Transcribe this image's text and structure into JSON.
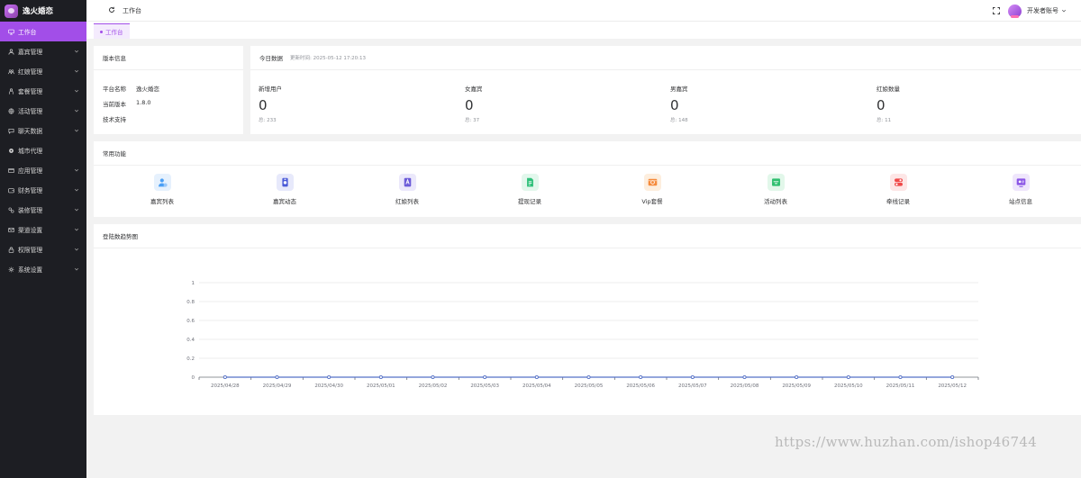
{
  "app": {
    "title": "逸火婚恋"
  },
  "sidebar": {
    "items": [
      {
        "label": "工作台",
        "icon": "monitor-icon",
        "active": true,
        "expandable": false
      },
      {
        "label": "嘉宾管理",
        "icon": "user-icon",
        "expandable": true
      },
      {
        "label": "红娘管理",
        "icon": "group-icon",
        "expandable": true
      },
      {
        "label": "套餐管理",
        "icon": "person-icon",
        "expandable": true
      },
      {
        "label": "活动管理",
        "icon": "globe-icon",
        "expandable": true
      },
      {
        "label": "聊天数据",
        "icon": "chat-icon",
        "expandable": true
      },
      {
        "label": "城市代理",
        "icon": "gear-dot-icon",
        "expandable": false
      },
      {
        "label": "应用管理",
        "icon": "app-icon",
        "expandable": true
      },
      {
        "label": "财务管理",
        "icon": "wallet-icon",
        "expandable": true
      },
      {
        "label": "装修管理",
        "icon": "brush-icon",
        "expandable": true
      },
      {
        "label": "渠道设置",
        "icon": "mail-icon",
        "expandable": true
      },
      {
        "label": "权限管理",
        "icon": "lock-icon",
        "expandable": true
      },
      {
        "label": "系统设置",
        "icon": "settings-icon",
        "expandable": true
      }
    ]
  },
  "header": {
    "breadcrumb": "工作台",
    "user_name": "开发者账号"
  },
  "tabs": {
    "active_label": "工作台"
  },
  "version_card": {
    "title": "版本信息",
    "rows": [
      {
        "key": "平台名称",
        "value": "逸火婚恋"
      },
      {
        "key": "当前版本",
        "value": "1.8.0"
      },
      {
        "key": "技术支持",
        "value": ""
      }
    ]
  },
  "today_card": {
    "title": "今日数据",
    "update_time": "更新时间: 2025-05-12 17:20:13",
    "stats": [
      {
        "label": "新增用户",
        "value": "0",
        "total": "总: 233"
      },
      {
        "label": "女嘉宾",
        "value": "0",
        "total": "总: 37"
      },
      {
        "label": "男嘉宾",
        "value": "0",
        "total": "总: 148"
      },
      {
        "label": "红娘数量",
        "value": "0",
        "total": "总: 11"
      }
    ]
  },
  "common_card": {
    "title": "常用功能",
    "items": [
      {
        "label": "嘉宾列表",
        "icon": "guest-list-icon",
        "color": "#4a9ff5",
        "bg": "#e6f1fd"
      },
      {
        "label": "嘉宾动态",
        "icon": "guest-moment-icon",
        "color": "#4b5bd8",
        "bg": "#e7e9fb"
      },
      {
        "label": "红娘列表",
        "icon": "matchmaker-list-icon",
        "color": "#6b5bd8",
        "bg": "#ebe8fb"
      },
      {
        "label": "提现记录",
        "icon": "withdraw-record-icon",
        "color": "#2fc07a",
        "bg": "#e2f7ec"
      },
      {
        "label": "Vip套餐",
        "icon": "vip-package-icon",
        "color": "#f58a3b",
        "bg": "#fdeede"
      },
      {
        "label": "活动列表",
        "icon": "activity-list-icon",
        "color": "#2fbf6f",
        "bg": "#e2f7ea"
      },
      {
        "label": "牵线记录",
        "icon": "match-record-icon",
        "color": "#f04848",
        "bg": "#fde6e6"
      },
      {
        "label": "站点信息",
        "icon": "site-info-icon",
        "color": "#8b55e6",
        "bg": "#efe6fc"
      }
    ]
  },
  "trend_card": {
    "title": "登陆数趋势图"
  },
  "chart_data": {
    "type": "line",
    "x": [
      "2025/04/28",
      "2025/04/29",
      "2025/04/30",
      "2025/05/01",
      "2025/05/02",
      "2025/05/03",
      "2025/05/04",
      "2025/05/05",
      "2025/05/06",
      "2025/05/07",
      "2025/05/08",
      "2025/05/09",
      "2025/05/10",
      "2025/05/11",
      "2025/05/12"
    ],
    "series": [
      {
        "values": [
          0,
          0,
          0,
          0,
          0,
          0,
          0,
          0,
          0,
          0,
          0,
          0,
          0,
          0,
          0
        ],
        "color": "#5470c6"
      }
    ],
    "yticks": [
      "0",
      "0.2",
      "0.4",
      "0.6",
      "0.8",
      "1"
    ],
    "ylim": [
      0,
      1
    ],
    "grid": true
  },
  "watermark": "https://www.huzhan.com/ishop46744"
}
